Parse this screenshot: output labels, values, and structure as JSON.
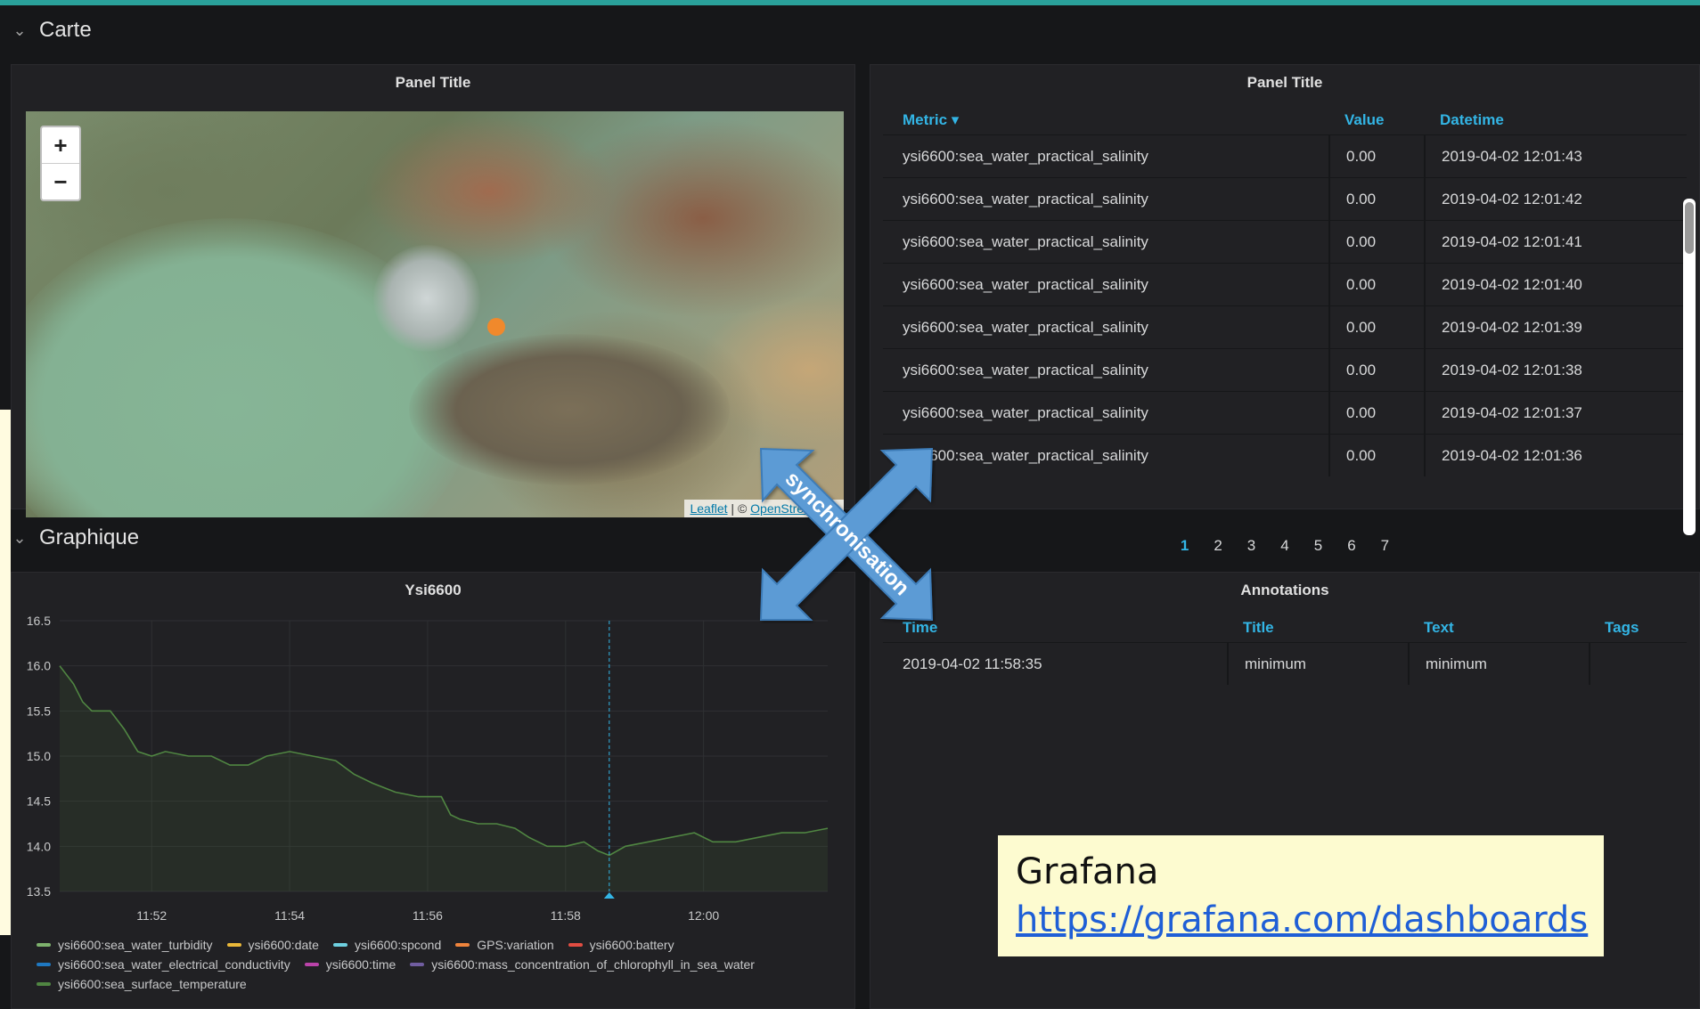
{
  "rows": {
    "carte": "Carte",
    "graphique": "Graphique"
  },
  "map_panel": {
    "title": "Panel Title",
    "zoom_in": "+",
    "zoom_out": "−",
    "attribution_leaflet": "Leaflet",
    "attribution_sep": " | © ",
    "attribution_osm": "OpenStreetMap"
  },
  "table_panel": {
    "title": "Panel Title",
    "columns": [
      "Metric ▾",
      "Value",
      "Datetime"
    ],
    "rows": [
      [
        "ysi6600:sea_water_practical_salinity",
        "0.00",
        "2019-04-02 12:01:43"
      ],
      [
        "ysi6600:sea_water_practical_salinity",
        "0.00",
        "2019-04-02 12:01:42"
      ],
      [
        "ysi6600:sea_water_practical_salinity",
        "0.00",
        "2019-04-02 12:01:41"
      ],
      [
        "ysi6600:sea_water_practical_salinity",
        "0.00",
        "2019-04-02 12:01:40"
      ],
      [
        "ysi6600:sea_water_practical_salinity",
        "0.00",
        "2019-04-02 12:01:39"
      ],
      [
        "ysi6600:sea_water_practical_salinity",
        "0.00",
        "2019-04-02 12:01:38"
      ],
      [
        "ysi6600:sea_water_practical_salinity",
        "0.00",
        "2019-04-02 12:01:37"
      ],
      [
        "ysi6600:sea_water_practical_salinity",
        "0.00",
        "2019-04-02 12:01:36"
      ]
    ],
    "pages": [
      "1",
      "2",
      "3",
      "4",
      "5",
      "6",
      "7"
    ],
    "active_page": "1"
  },
  "chart_panel": {
    "title": "Ysi6600",
    "legend": [
      {
        "name": "ysi6600:sea_water_turbidity",
        "color": "#7eb26d"
      },
      {
        "name": "ysi6600:date",
        "color": "#eab839"
      },
      {
        "name": "ysi6600:spcond",
        "color": "#6ed0e0"
      },
      {
        "name": "GPS:variation",
        "color": "#ef843c"
      },
      {
        "name": "ysi6600:battery",
        "color": "#e24d42"
      },
      {
        "name": "ysi6600:sea_water_electrical_conductivity",
        "color": "#1f78c1"
      },
      {
        "name": "ysi6600:time",
        "color": "#ba43a9"
      },
      {
        "name": "ysi6600:mass_concentration_of_chlorophyll_in_sea_water",
        "color": "#705da0"
      },
      {
        "name": "ysi6600:sea_surface_temperature",
        "color": "#508642"
      }
    ]
  },
  "annotations_panel": {
    "title": "Annotations",
    "columns": [
      "Time",
      "Title",
      "Text",
      "Tags"
    ],
    "rows": [
      [
        "2019-04-02 11:58:35",
        "minimum",
        "minimum",
        ""
      ]
    ]
  },
  "sync_label": "synchronisation",
  "callout": {
    "line1": "Grafana",
    "line2": "https://grafana.com/dashboards"
  },
  "chart_data": {
    "type": "line",
    "title": "Ysi6600",
    "xlabel": "",
    "ylabel": "",
    "x_ticks": [
      "11:52",
      "11:54",
      "11:56",
      "11:58",
      "12:00"
    ],
    "y_ticks": [
      "16.5",
      "16.0",
      "15.5",
      "15.0",
      "14.5",
      "14.0",
      "13.5"
    ],
    "ylim": [
      13.5,
      16.5
    ],
    "xlim_minutes": [
      11.5,
      21.8
    ],
    "grid": true,
    "legend_position": "bottom",
    "annotation_marker": {
      "time": "11:58:35",
      "label": "minimum"
    },
    "series": [
      {
        "name": "ysi6600:sea_surface_temperature",
        "color": "#508642",
        "points": [
          [
            11.5,
            16.0
          ],
          [
            11.8,
            15.8
          ],
          [
            12.0,
            15.6
          ],
          [
            12.2,
            15.5
          ],
          [
            12.6,
            15.5
          ],
          [
            12.9,
            15.3
          ],
          [
            13.2,
            15.05
          ],
          [
            13.5,
            15.0
          ],
          [
            13.8,
            15.05
          ],
          [
            14.3,
            15.0
          ],
          [
            14.8,
            15.0
          ],
          [
            15.2,
            14.9
          ],
          [
            15.6,
            14.9
          ],
          [
            16.0,
            15.0
          ],
          [
            16.5,
            15.05
          ],
          [
            17.0,
            15.0
          ],
          [
            17.5,
            14.95
          ],
          [
            17.9,
            14.8
          ],
          [
            18.3,
            14.7
          ],
          [
            18.8,
            14.6
          ],
          [
            19.3,
            14.55
          ],
          [
            19.8,
            14.55
          ],
          [
            20.0,
            14.35
          ],
          [
            20.2,
            14.3
          ],
          [
            20.6,
            14.25
          ],
          [
            21.0,
            14.25
          ],
          [
            21.4,
            14.2
          ],
          [
            21.7,
            14.1
          ],
          [
            22.1,
            14.0
          ],
          [
            22.5,
            14.0
          ],
          [
            22.9,
            14.05
          ],
          [
            23.2,
            13.95
          ],
          [
            23.45,
            13.9
          ],
          [
            23.8,
            14.0
          ],
          [
            24.3,
            14.05
          ],
          [
            24.8,
            14.1
          ],
          [
            25.3,
            14.15
          ],
          [
            25.7,
            14.05
          ],
          [
            26.2,
            14.05
          ],
          [
            26.7,
            14.1
          ],
          [
            27.2,
            14.15
          ],
          [
            27.7,
            14.15
          ],
          [
            28.2,
            14.2
          ]
        ]
      }
    ]
  }
}
